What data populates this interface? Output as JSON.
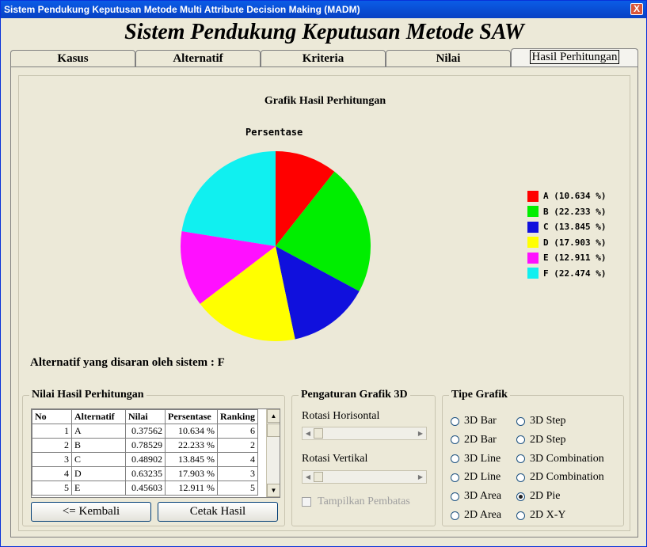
{
  "window": {
    "title": "Sistem Pendukung Keputusan Metode Multi Attribute Decision Making (MADM)",
    "close_label": "X"
  },
  "app_title": "Sistem Pendukung Keputusan Metode SAW",
  "tabs": [
    {
      "label": "Kasus"
    },
    {
      "label": "Alternatif"
    },
    {
      "label": "Kriteria"
    },
    {
      "label": "Nilai"
    },
    {
      "label": "Hasil Perhitungan",
      "active": true
    }
  ],
  "chart_data": {
    "type": "pie",
    "title": "Grafik Hasil Perhitungan",
    "subtitle": "Persentase",
    "legend_placement": "right",
    "categories": [
      "A",
      "B",
      "C",
      "D",
      "E",
      "F"
    ],
    "values": [
      10.634,
      22.233,
      13.845,
      17.903,
      12.911,
      22.474
    ],
    "legend_labels": [
      "A (10.634 %)",
      "B (22.233 %)",
      "C (13.845 %)",
      "D (17.903 %)",
      "E (12.911 %)",
      "F (22.474 %)"
    ],
    "colors": [
      "#ff0000",
      "#00ee00",
      "#1010dd",
      "#ffff00",
      "#ff10ff",
      "#10f0f0"
    ]
  },
  "suggestion": "Alternatif yang disaran oleh sistem : F",
  "results": {
    "title": "Nilai Hasil Perhitungan",
    "headers": [
      "No",
      "Alternatif",
      "Nilai",
      "Persentase",
      "Ranking"
    ],
    "rows": [
      [
        "1",
        "A",
        "0.37562",
        "10.634 %",
        "6"
      ],
      [
        "2",
        "B",
        "0.78529",
        "22.233 %",
        "2"
      ],
      [
        "3",
        "C",
        "0.48902",
        "13.845 %",
        "4"
      ],
      [
        "4",
        "D",
        "0.63235",
        "17.903 %",
        "3"
      ],
      [
        "5",
        "E",
        "0.45603",
        "12.911 %",
        "5"
      ]
    ],
    "back_label": "<= Kembali",
    "print_label": "Cetak Hasil"
  },
  "settings": {
    "title": "Pengaturan Grafik 3D",
    "horizontal_label": "Rotasi Horisontal",
    "vertical_label": "Rotasi Vertikal",
    "divider_label": "Tampilkan Pembatas"
  },
  "chart_type": {
    "title": "Tipe Grafik",
    "options": [
      "3D Bar",
      "3D Step",
      "2D Bar",
      "2D Step",
      "3D Line",
      "3D Combination",
      "2D Line",
      "2D Combination",
      "3D Area",
      "2D Pie",
      "2D Area",
      "2D X-Y"
    ],
    "selected": "2D Pie"
  }
}
